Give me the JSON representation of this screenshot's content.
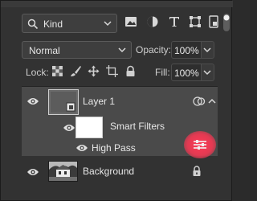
{
  "filter": {
    "kind_label": "Kind",
    "icons": [
      "image-filter-icon",
      "adjustment-filter-icon",
      "type-filter-icon",
      "shape-filter-icon",
      "smart-object-filter-icon",
      "filter-toggle-icon"
    ]
  },
  "blend": {
    "mode": "Normal",
    "opacity_label": "Opacity:",
    "opacity_value": "100%"
  },
  "lock": {
    "label": "Lock:",
    "icons": [
      "lock-transparent-icon",
      "lock-image-icon",
      "lock-position-icon",
      "lock-artboard-icon",
      "lock-all-icon"
    ],
    "fill_label": "Fill:",
    "fill_value": "100%"
  },
  "layers": {
    "layer1": {
      "name": "Layer 1"
    },
    "smart_filters": {
      "name": "Smart Filters"
    },
    "high_pass": {
      "name": "High Pass"
    },
    "background": {
      "name": "Background"
    }
  },
  "colors": {
    "panel_bg": "#323232",
    "selected_row": "#4a4a4a",
    "highlight": "#e23a52"
  }
}
